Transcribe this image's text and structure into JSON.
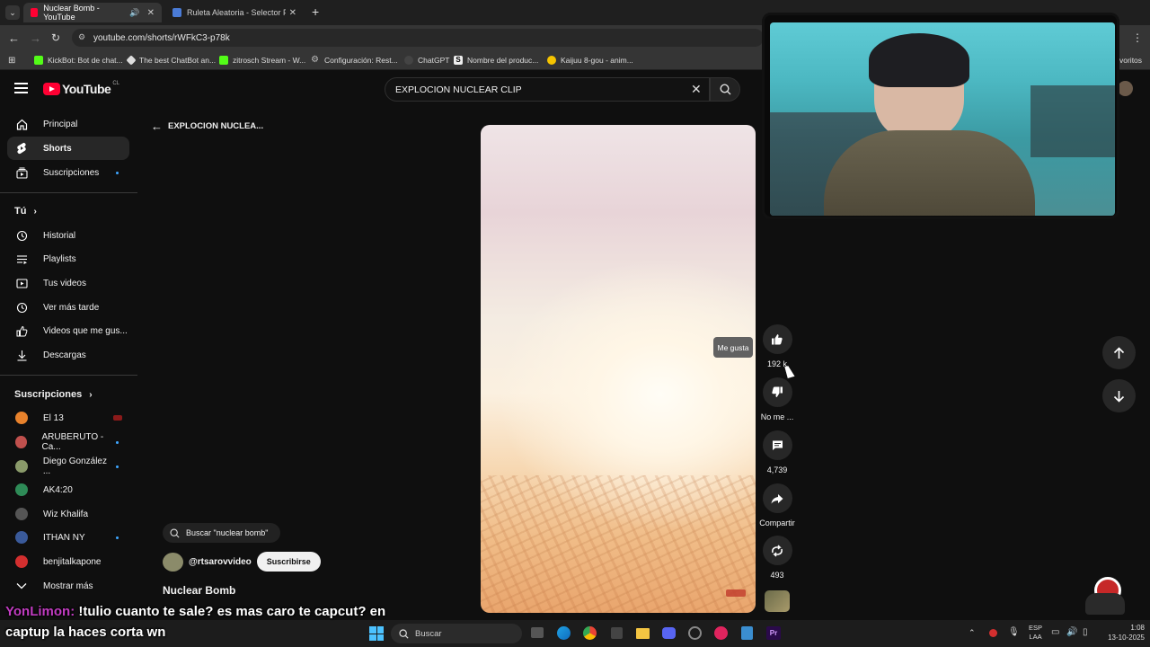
{
  "browser": {
    "tabs": [
      {
        "title": "Nuclear Bomb - YouTube",
        "favicon_color": "#ff0033"
      },
      {
        "title": "Ruleta Aleatoria - Selector Pers",
        "favicon_color": "#4a7bd6"
      }
    ],
    "url": "youtube.com/shorts/rWFkC3-p78k",
    "bookmarks": [
      {
        "label": "KickBot: Bot de chat...",
        "color": "#53fc18"
      },
      {
        "label": "The best ChatBot an...",
        "color": "#dddddd"
      },
      {
        "label": "zitrosch Stream - W...",
        "color": "#53fc18"
      },
      {
        "label": "Configuración: Rest...",
        "color": "#bbbbbb"
      },
      {
        "label": "ChatGPT",
        "color": "#444444"
      },
      {
        "label": "Nombre del produc...",
        "color": "#222222"
      },
      {
        "label": "Kaijuu 8-gou - anim...",
        "color": "#f5c400"
      }
    ],
    "bookmarks_overflow": "voritos"
  },
  "youtube": {
    "logo_text": "YouTube",
    "country_code": "CL",
    "search_query": "EXPLOCION NUCLEAR CLIP",
    "back_label": "EXPLOCION NUCLEA...",
    "sidebar": {
      "main": [
        {
          "label": "Principal",
          "icon": "home-icon"
        },
        {
          "label": "Shorts",
          "icon": "shorts-icon",
          "active": true
        },
        {
          "label": "Suscripciones",
          "icon": "subscriptions-icon",
          "dot": true
        }
      ],
      "you_title": "Tú",
      "you": [
        {
          "label": "Historial",
          "icon": "history-icon"
        },
        {
          "label": "Playlists",
          "icon": "playlists-icon"
        },
        {
          "label": "Tus videos",
          "icon": "your-videos-icon"
        },
        {
          "label": "Ver más tarde",
          "icon": "watch-later-icon"
        },
        {
          "label": "Videos que me gus...",
          "icon": "liked-videos-icon"
        },
        {
          "label": "Descargas",
          "icon": "downloads-icon"
        }
      ],
      "subs_title": "Suscripciones",
      "subs": [
        {
          "label": "El 13",
          "color": "#e8822c",
          "live": true
        },
        {
          "label": "ARUBERUTO - Ca...",
          "color": "#c0504d",
          "dot": true
        },
        {
          "label": "Diego González ...",
          "color": "#8a9a6a",
          "dot": true
        },
        {
          "label": "AK4:20",
          "color": "#2e8b57"
        },
        {
          "label": "Wiz Khalifa",
          "color": "#555555"
        },
        {
          "label": "ITHAN NY",
          "color": "#3a5a9a",
          "dot": true
        },
        {
          "label": "benjitalkapone",
          "color": "#d32f2f"
        }
      ],
      "show_more": "Mostrar más"
    },
    "short": {
      "search_chip": "Buscar \"nuclear bomb\"",
      "channel": "@rtsarovvideo",
      "subscribe": "Suscribirse",
      "title": "Nuclear Bomb"
    },
    "actions": {
      "like_count": "192 k",
      "like_tooltip": "Me gusta",
      "dislike_label": "No me ...",
      "comments_count": "4,739",
      "share_label": "Compartir",
      "remix_count": "493"
    }
  },
  "overlay_chat": {
    "user": "YonLimon:",
    "message": " !tulio cuanto te sale? es mas caro te capcut? en",
    "line2": "captup la haces corta wn",
    "user_color": "#c13cc1"
  },
  "taskbar": {
    "search_placeholder": "Buscar",
    "lang": "ESP",
    "lang2": "LAA",
    "time": "1:08",
    "date": "13-10-2025"
  }
}
